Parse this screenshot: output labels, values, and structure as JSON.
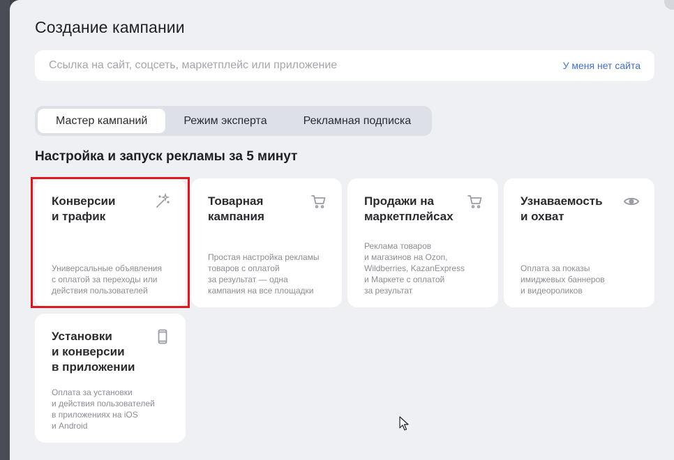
{
  "modal": {
    "title": "Создание кампании",
    "url_placeholder": "Ссылка на сайт, соцсеть, маркетплейс или приложение",
    "no_site_link": "У меня нет сайта"
  },
  "tabs": [
    {
      "label": "Мастер кампаний",
      "active": true
    },
    {
      "label": "Режим эксперта",
      "active": false
    },
    {
      "label": "Рекламная подписка",
      "active": false
    }
  ],
  "section_title": "Настройка и запуск рекламы за 5 минут",
  "cards": [
    {
      "title": "Конверсии\nи трафик",
      "icon": "magic-wand-icon",
      "description": "Универсальные объявления\nс оплатой за переходы или\nдействия пользователей",
      "highlighted": true
    },
    {
      "title": "Товарная\nкампания",
      "icon": "cart-icon",
      "description": "Простая настройка рекламы\nтоваров с оплатой\nза результат — одна\nкампания на все площадки"
    },
    {
      "title": "Продажи на\nмаркетплейсах",
      "icon": "cart-icon",
      "description": "Реклама товаров\nи магазинов на Ozon,\nWildberries, KazanExpress\nи Маркете с оплатой\nза результат"
    },
    {
      "title": "Узнаваемость\nи охват",
      "icon": "eye-icon",
      "description": "Оплата за показы\nимиджевых баннеров\nи видеороликов"
    },
    {
      "title": "Установки\nи конверсии\nв приложении",
      "icon": "smartphone-icon",
      "description": "Оплата за установки\nи действия пользователей\nв приложениях на iOS\nи Android"
    }
  ],
  "colors": {
    "accent_link": "#3f6fd1",
    "highlight_border": "#e0161e",
    "modal_background": "#eef0f4"
  }
}
